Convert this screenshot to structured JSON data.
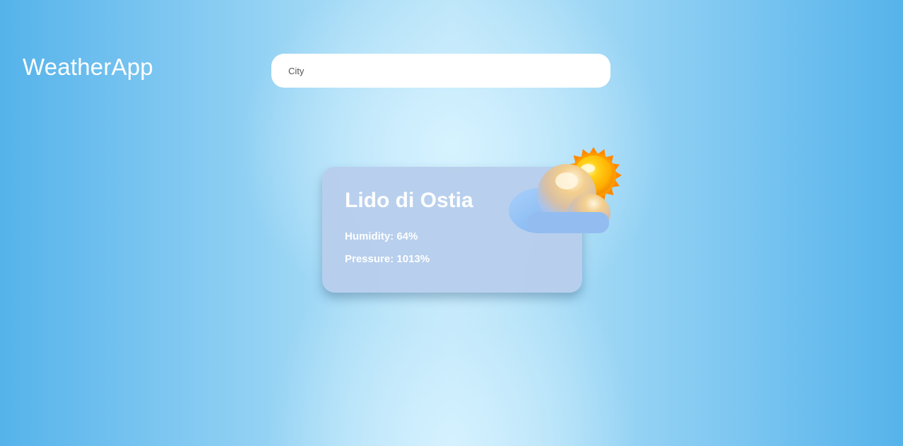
{
  "app": {
    "title": "WeatherApp"
  },
  "search": {
    "placeholder": "City"
  },
  "weather": {
    "city": "Lido di Ostia",
    "humidity_label": "Humidity: ",
    "humidity_value": "64%",
    "pressure_label": "Pressure: ",
    "pressure_value": "1013%",
    "icon": "partly-cloudy-icon"
  },
  "colors": {
    "background_edge": "#55b3ea",
    "background_center": "#d6f2ff",
    "card": "#b7ceec",
    "text": "#ffffff"
  }
}
